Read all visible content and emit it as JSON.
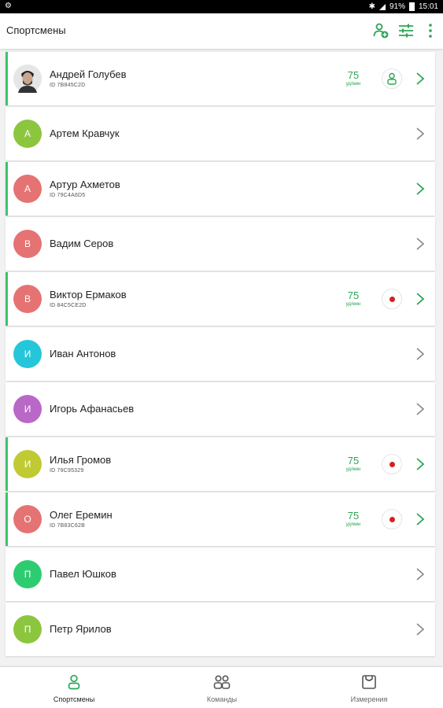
{
  "header": {
    "title": "Спортсмены",
    "actions": [
      {
        "icon": "add-athlete-icon"
      },
      {
        "icon": "filter-sliders-icon"
      },
      {
        "icon": "more-vert-icon"
      }
    ]
  },
  "status": {
    "battery": "91%",
    "time": "15:01"
  },
  "colors": {
    "accent": "#2aa655",
    "active_border": "#3cc46c",
    "record": "#d62020"
  },
  "athletes": [
    {
      "name": "Андрей Голубев",
      "id": "ID 7B845C2D",
      "hr": "75",
      "hr_unit": "уд/мин",
      "status": "connected",
      "avatar": "photo",
      "active": true
    },
    {
      "name": "Артем Кравчук",
      "initial": "А",
      "avatar_color": "#8cc63f",
      "active": false
    },
    {
      "name": "Артур Ахметов",
      "id": "ID 79C4A6D5",
      "initial": "А",
      "avatar_color": "#e57373",
      "active": true
    },
    {
      "name": "Вадим Серов",
      "initial": "В",
      "avatar_color": "#e57373",
      "active": false
    },
    {
      "name": "Виктор Ермаков",
      "id": "ID 84C5CE2D",
      "hr": "75",
      "hr_unit": "уд/мин",
      "status": "recording",
      "initial": "В",
      "avatar_color": "#e57373",
      "active": true
    },
    {
      "name": "Иван Антонов",
      "initial": "И",
      "avatar_color": "#26c6da",
      "active": false
    },
    {
      "name": "Игорь Афанасьев",
      "initial": "И",
      "avatar_color": "#ba68c8",
      "active": false
    },
    {
      "name": "Илья Громов",
      "id": "ID 79C95329",
      "hr": "75",
      "hr_unit": "уд/мин",
      "status": "recording",
      "initial": "И",
      "avatar_color": "#c0ca33",
      "active": true
    },
    {
      "name": "Олег Еремин",
      "id": "ID 7B83C62B",
      "hr": "75",
      "hr_unit": "уд/мин",
      "status": "recording",
      "initial": "О",
      "avatar_color": "#e57373",
      "active": true
    },
    {
      "name": "Павел Юшков",
      "initial": "П",
      "avatar_color": "#2ecc71",
      "active": false
    },
    {
      "name": "Петр Ярилов",
      "initial": "П",
      "avatar_color": "#8cc63f",
      "active": false
    }
  ],
  "bottom_nav": [
    {
      "label": "Спортсмены",
      "icon": "athlete-icon",
      "selected": true
    },
    {
      "label": "Команды",
      "icon": "teams-icon",
      "selected": false
    },
    {
      "label": "Измерения",
      "icon": "measurements-icon",
      "selected": false
    }
  ]
}
